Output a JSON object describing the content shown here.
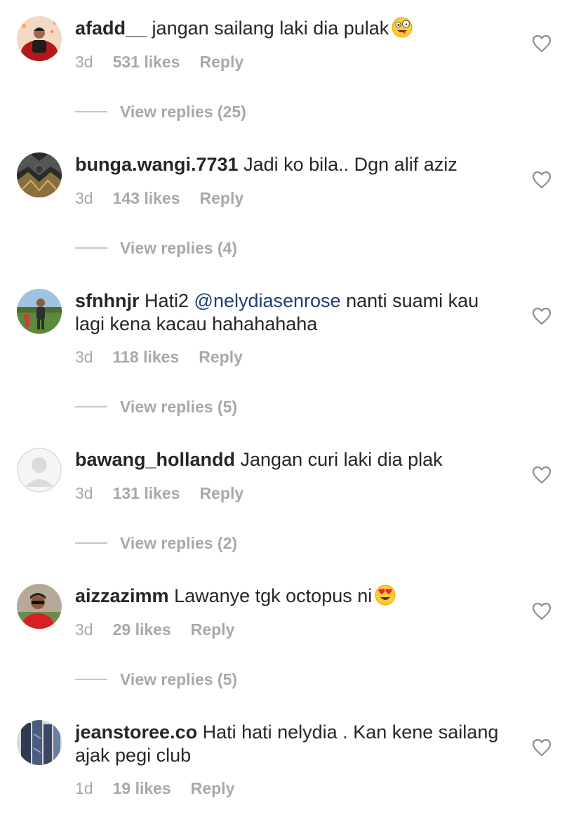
{
  "comments": [
    {
      "username": "afadd__",
      "segments": [
        {
          "text": " jangan sailang laki dia pulak",
          "type": "plain"
        }
      ],
      "emoji": "zany-face",
      "age": "3d",
      "likes": "531 likes",
      "reply": "Reply",
      "view_replies": "View replies (25)",
      "avatar": "photo-man-red-chair"
    },
    {
      "username": "bunga.wangi.7731",
      "segments": [
        {
          "text": " Jadi ko bila.. Dgn alif aziz",
          "type": "plain"
        }
      ],
      "emoji": null,
      "age": "3d",
      "likes": "143 likes",
      "reply": "Reply",
      "view_replies": "View replies (4)",
      "avatar": "photo-dark-pattern"
    },
    {
      "username": "sfnhnjr",
      "segments": [
        {
          "text": " Hati2 ",
          "type": "plain"
        },
        {
          "text": "@nelydiasenrose",
          "type": "mention"
        },
        {
          "text": " nanti suami kau lagi kena kacau hahahahaha",
          "type": "plain"
        }
      ],
      "emoji": null,
      "age": "3d",
      "likes": "118 likes",
      "reply": "Reply",
      "view_replies": "View replies (5)",
      "avatar": "photo-outdoor-field"
    },
    {
      "username": "bawang_hollandd",
      "segments": [
        {
          "text": " Jangan curi laki dia plak",
          "type": "plain"
        }
      ],
      "emoji": null,
      "age": "3d",
      "likes": "131 likes",
      "reply": "Reply",
      "view_replies": "View replies (2)",
      "avatar": "default-avatar"
    },
    {
      "username": "aizzazimm",
      "segments": [
        {
          "text": " Lawanye tgk octopus ni",
          "type": "plain"
        }
      ],
      "emoji": "heart-eyes",
      "age": "3d",
      "likes": "29 likes",
      "reply": "Reply",
      "view_replies": "View replies (5)",
      "avatar": "photo-man-red-shirt"
    },
    {
      "username": "jeanstoree.co",
      "segments": [
        {
          "text": " Hati hati nelydia . Kan kene sailang ajak pegi club",
          "type": "plain"
        }
      ],
      "emoji": null,
      "age": "1d",
      "likes": "19 likes",
      "reply": "Reply",
      "view_replies": null,
      "avatar": "photo-jeans"
    }
  ],
  "colors": {
    "text": "#262626",
    "meta": "#a8a8a8",
    "mention": "#1e3f72",
    "divider": "#c7c7c7"
  },
  "icons": {
    "like": "heart-outline-icon"
  }
}
